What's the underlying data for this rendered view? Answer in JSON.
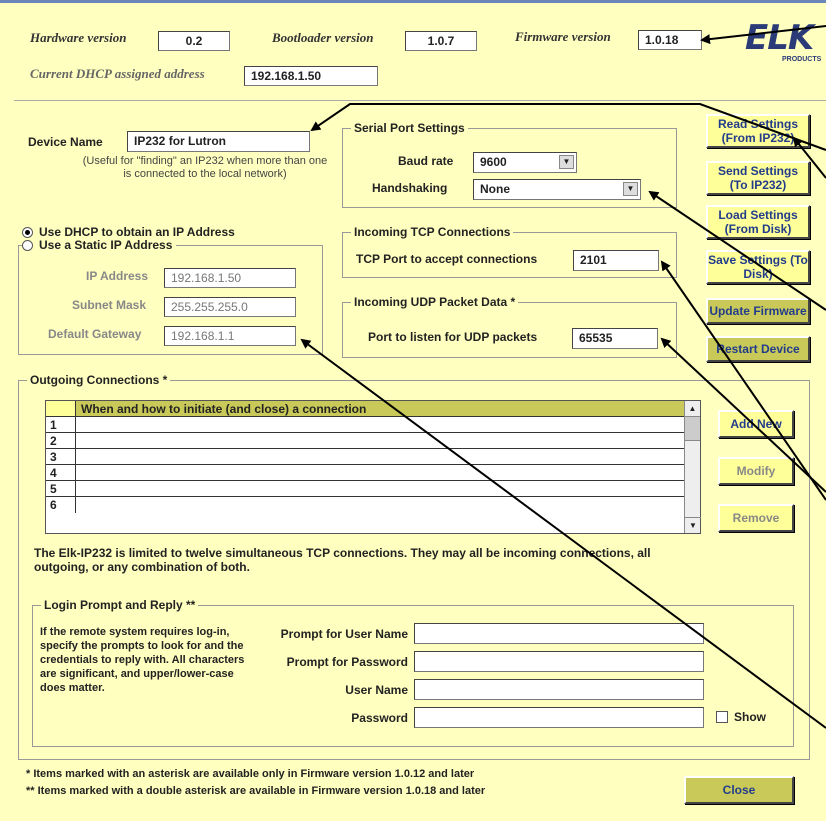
{
  "header": {
    "hardware_label": "Hardware version",
    "hardware_value": "0.2",
    "bootloader_label": "Bootloader version",
    "bootloader_value": "1.0.7",
    "firmware_label": "Firmware version",
    "firmware_value": "1.0.18",
    "dhcp_label": "Current DHCP assigned address",
    "dhcp_value": "192.168.1.50",
    "logo_text": "ELK",
    "logo_sub": "PRODUCTS"
  },
  "device": {
    "name_label": "Device Name",
    "name_value": "IP232 for Lutron",
    "help": "(Useful for \"finding\" an IP232 when more than one is connected to the local network)"
  },
  "ip": {
    "dhcp_option": "Use DHCP to obtain an IP Address",
    "static_option": "Use a Static IP Address",
    "ip_label": "IP Address",
    "ip_value": "192.168.1.50",
    "mask_label": "Subnet Mask",
    "mask_value": "255.255.255.0",
    "gateway_label": "Default Gateway",
    "gateway_value": "192.168.1.1"
  },
  "serial": {
    "title": "Serial Port Settings",
    "baud_label": "Baud rate",
    "baud_value": "9600",
    "hand_label": "Handshaking",
    "hand_value": "None"
  },
  "tcp": {
    "title": "Incoming TCP Connections",
    "port_label": "TCP Port to accept connections",
    "port_value": "2101"
  },
  "udp": {
    "title": "Incoming UDP Packet Data *",
    "port_label": "Port to listen for UDP packets",
    "port_value": "65535"
  },
  "buttons": {
    "read": "Read Settings (From IP232)",
    "send": "Send Settings (To IP232)",
    "load": "Load Settings (From Disk)",
    "save": "Save Settings (To Disk)",
    "update": "Update Firmware",
    "restart": "Restart Device",
    "add": "Add New",
    "modify": "Modify",
    "remove": "Remove",
    "close": "Close"
  },
  "outgoing": {
    "title": "Outgoing Connections *",
    "column": "When and how to initiate (and close) a connection",
    "rows": [
      "1",
      "2",
      "3",
      "4",
      "5",
      "6"
    ],
    "note": "The Elk-IP232 is limited to twelve simultaneous TCP connections.  They may all be incoming connections, all outgoing, or any combination of both."
  },
  "login": {
    "title": "Login Prompt and Reply **",
    "desc": "If the remote system requires log-in, specify the prompts to look for and the credentials to reply with.  All characters are significant, and upper/lower-case does matter.",
    "prompt_user": "Prompt for User Name",
    "prompt_pass": "Prompt for Password",
    "user_name": "User Name",
    "password": "Password",
    "show": "Show"
  },
  "footer": {
    "note1": "* Items marked with an asterisk are available only in Firmware version  1.0.12 and later",
    "note2": "** Items marked with a double asterisk are available in Firmware version 1.0.18 and later"
  }
}
